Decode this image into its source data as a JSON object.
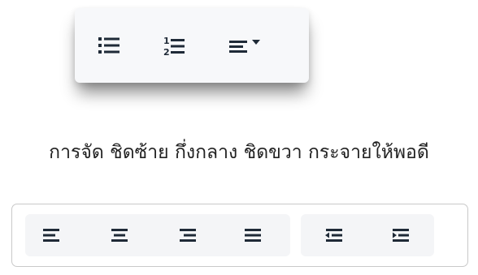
{
  "list_toolbar": {
    "buttons": [
      {
        "name": "bulleted-list",
        "icon": "bullet-list-icon"
      },
      {
        "name": "numbered-list",
        "icon": "numbered-list-icon"
      },
      {
        "name": "alignment-dropdown",
        "icon": "align-left-dropdown-icon"
      }
    ],
    "numbered_list_digits": [
      "1",
      "2"
    ]
  },
  "caption": "การจัด ชิดซ้าย กึ่งกลาง ชิดขวา กระจายให้พอดี",
  "alignment_toolbar": {
    "align_buttons": [
      {
        "name": "align-left",
        "icon": "align-left-icon"
      },
      {
        "name": "align-center",
        "icon": "align-center-icon"
      },
      {
        "name": "align-right",
        "icon": "align-right-icon"
      },
      {
        "name": "align-justify",
        "icon": "align-justify-icon"
      }
    ],
    "indent_buttons": [
      {
        "name": "decrease-indent",
        "icon": "outdent-icon"
      },
      {
        "name": "increase-indent",
        "icon": "indent-icon"
      }
    ]
  },
  "colors": {
    "icon": "#1f2a37",
    "toolbar_bg": "#f7f8fa",
    "group_bg": "#f4f5f7",
    "panel_border": "#c9c9c9"
  }
}
